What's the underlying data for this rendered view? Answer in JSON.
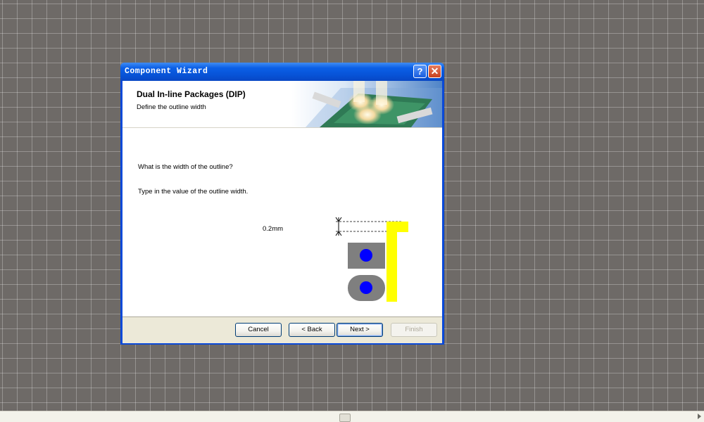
{
  "window": {
    "title": "Component Wizard",
    "help_glyph": "?",
    "close_glyph": "✕"
  },
  "header": {
    "title": "Dual In-line Packages (DIP)",
    "subtitle": "Define the outline width"
  },
  "content": {
    "question": "What is the width of the outline?",
    "instruction": "Type in the value of the outline width.",
    "outline_width_value": "0.2mm"
  },
  "diagram": {
    "pad_color": "#7f7f7f",
    "hole_color": "#0000ff",
    "outline_color": "#ffff00",
    "icon": "outline-width-diagram"
  },
  "buttons": {
    "cancel": "Cancel",
    "back": "< Back",
    "next": "Next >",
    "finish": "Finish"
  },
  "colors": {
    "titlebar": "#0752d6",
    "desktop": "#6e6a67",
    "footer": "#ece9d8"
  }
}
